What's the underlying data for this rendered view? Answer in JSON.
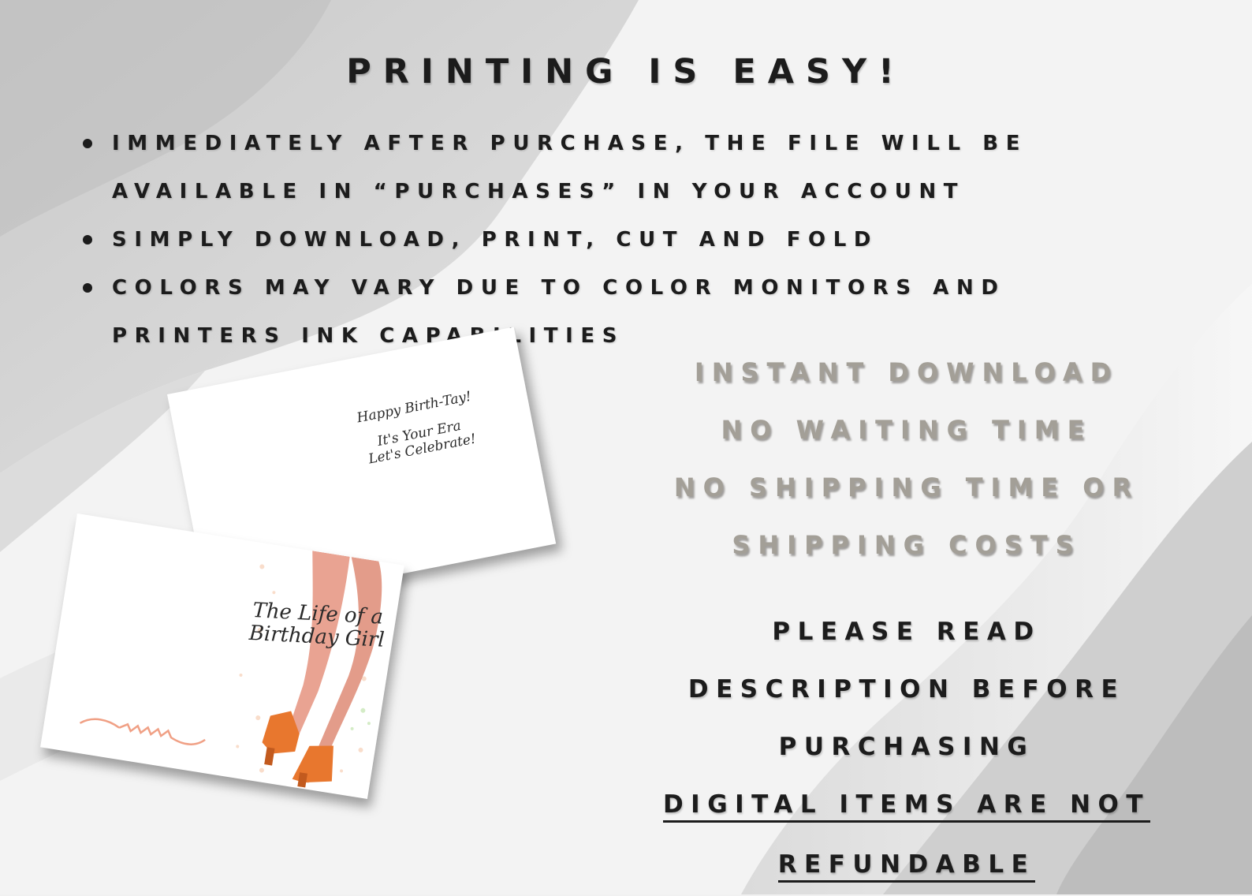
{
  "title": "PRINTING IS EASY!",
  "bullets": [
    "IMMEDIATELY AFTER PURCHASE, THE FILE WILL BE AVAILABLE IN “PURCHASES” IN YOUR ACCOUNT",
    "SIMPLY DOWNLOAD, PRINT, CUT AND FOLD",
    "COLORS MAY VARY DUE TO COLOR MONITORS AND PRINTERS INK CAPABILITIES"
  ],
  "bullet_lines": {
    "b1_l1": "IMMEDIATELY AFTER PURCHASE, THE FILE WILL BE",
    "b1_l2": "AVAILABLE IN “PURCHASES” IN YOUR ACCOUNT",
    "b2_l1": "SIMPLY DOWNLOAD, PRINT, CUT AND FOLD",
    "b3_l1": "COLORS MAY VARY DUE TO COLOR MONITORS AND",
    "b3_l2": "PRINTERS INK CAPABILITIES"
  },
  "gray_text": {
    "line1": "INSTANT DOWNLOAD",
    "line2": "NO WAITING TIME",
    "line3": "NO SHIPPING TIME OR",
    "line4": "SHIPPING COSTS"
  },
  "notice": {
    "line1": "PLEASE READ",
    "line2": "DESCRIPTION BEFORE",
    "line3": "PURCHASING",
    "underlined1": "DIGITAL ITEMS ARE NOT",
    "underlined2": "REFUNDABLE"
  },
  "card": {
    "back_line1": "Happy Birth-Tay!",
    "back_line2": "It's Your Era",
    "back_line3": "Let's Celebrate!",
    "front_title_1": "The Life of a",
    "front_title_2": "Birthday Girl"
  },
  "colors": {
    "text_dark": "#1c1c1c",
    "text_gray": "#a39f97",
    "boot_orange": "#e8772e",
    "flourish": "#f0a085"
  }
}
